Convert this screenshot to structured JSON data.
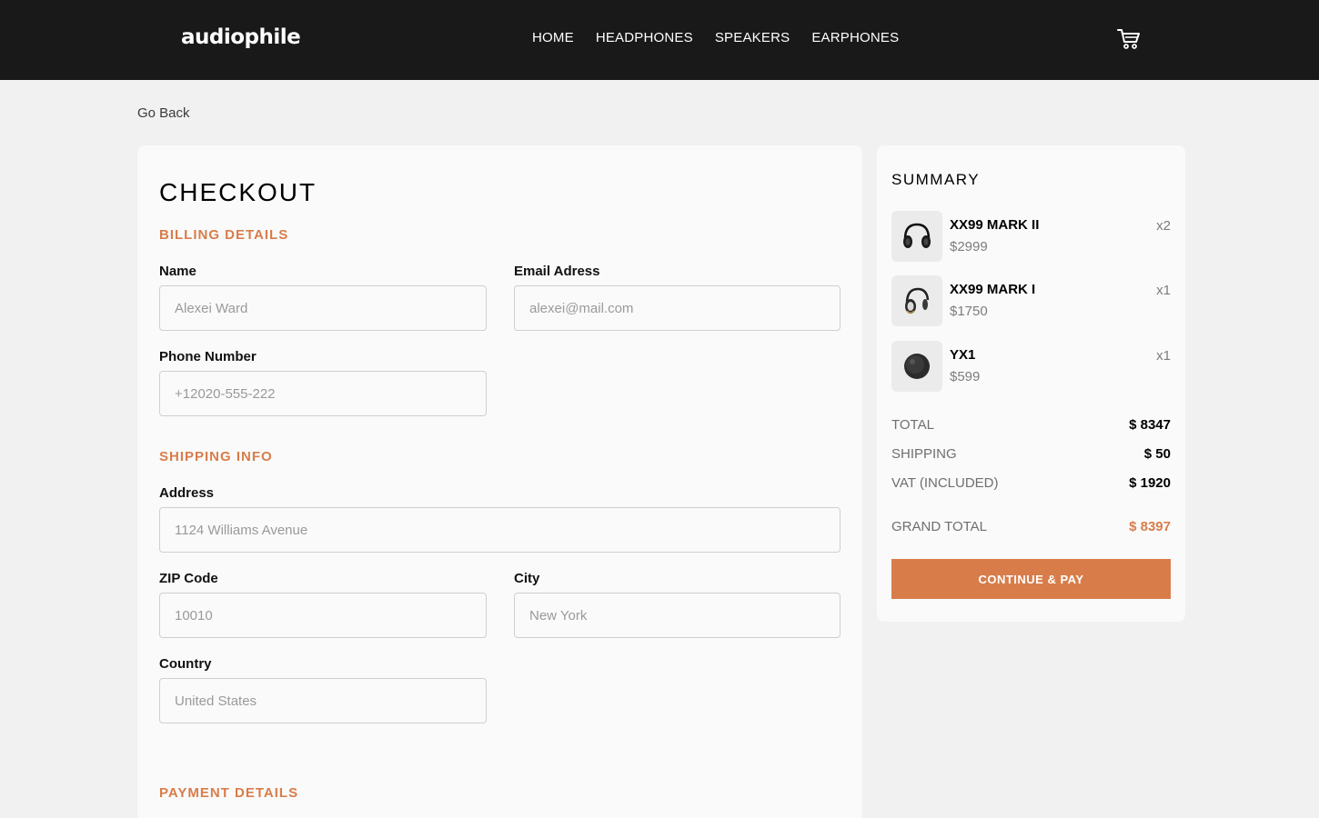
{
  "header": {
    "logo": "audiophile",
    "nav": [
      "HOME",
      "HEADPHONES",
      "SPEAKERS",
      "EARPHONES"
    ],
    "cart_icon": "cart-icon"
  },
  "go_back": "Go Back",
  "checkout": {
    "title": "CHECKOUT",
    "billing_title": "BILLING DETAILS",
    "name_label": "Name",
    "name_placeholder": "Alexei Ward",
    "email_label": "Email Adress",
    "email_placeholder": "alexei@mail.com",
    "phone_label": "Phone Number",
    "phone_placeholder": "+12020-555-222",
    "shipping_title": "SHIPPING INFO",
    "address_label": "Address",
    "address_placeholder": "1124 Williams Avenue",
    "zip_label": "ZIP Code",
    "zip_placeholder": "10010",
    "city_label": "City",
    "city_placeholder": "New York",
    "country_label": "Country",
    "country_placeholder": "United States",
    "payment_title": "PAYMENT DETAILS"
  },
  "summary": {
    "title": "SUMMARY",
    "items": [
      {
        "name": "XX99 MARK II",
        "price": "$2999",
        "qty": "x2",
        "icon": "headphones-icon"
      },
      {
        "name": "XX99 MARK I",
        "price": "$1750",
        "qty": "x1",
        "icon": "headphones-icon"
      },
      {
        "name": "YX1",
        "price": "$599",
        "qty": "x1",
        "icon": "earphones-icon"
      }
    ],
    "total_label": "TOTAL",
    "total_value": "$ 8347",
    "shipping_label": "SHIPPING",
    "shipping_value": "$ 50",
    "vat_label": "VAT (INCLUDED)",
    "vat_value": "$ 1920",
    "grand_label": "GRAND TOTAL",
    "grand_value": "$ 8397",
    "pay_button": "CONTINUE & PAY"
  },
  "colors": {
    "accent": "#d87d4a",
    "header_bg": "#191919",
    "page_bg": "#f1f1f1"
  }
}
